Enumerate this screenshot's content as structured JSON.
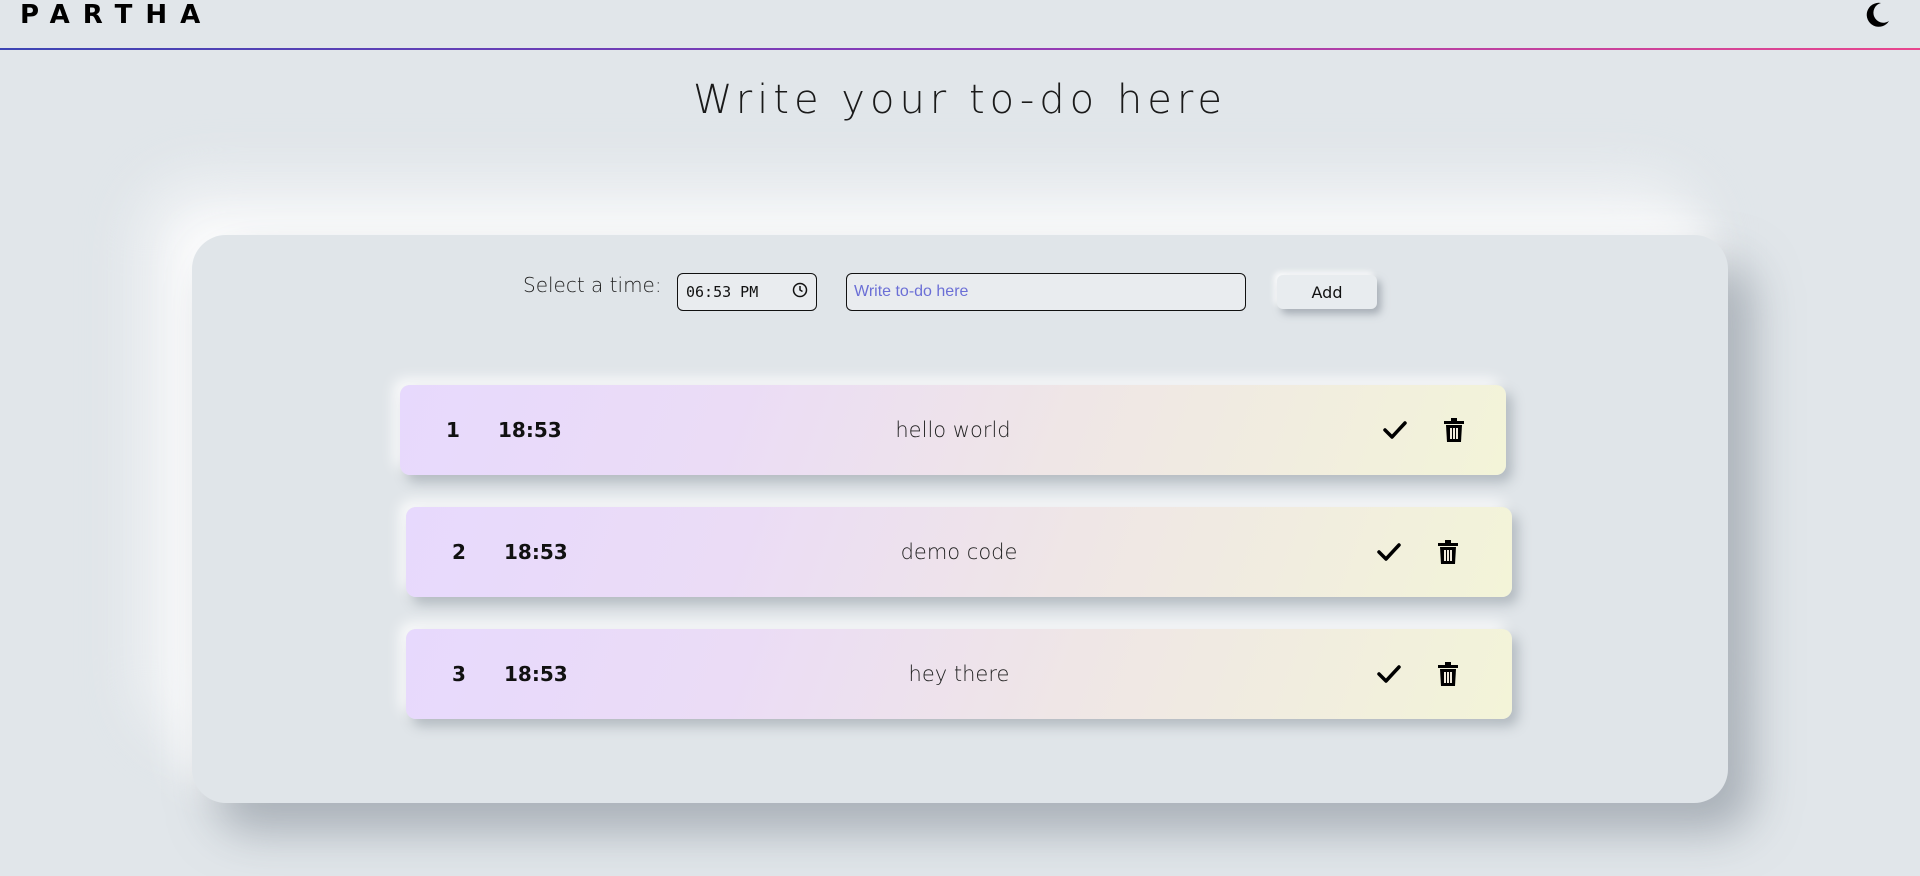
{
  "header": {
    "brand": "PARTHA",
    "theme_toggle_icon": "moon-icon"
  },
  "page": {
    "title": "Write your to-do here"
  },
  "form": {
    "time_label": "Select a time:",
    "time_value": "06:53 PM",
    "todo_placeholder": "Write to-do here",
    "todo_value": "",
    "add_label": "Add"
  },
  "todos": [
    {
      "num": "1",
      "time": "18:53",
      "text": "hello world"
    },
    {
      "num": "2",
      "time": "18:53",
      "text": "demo code"
    },
    {
      "num": "3",
      "time": "18:53",
      "text": "hey there"
    }
  ],
  "colors": {
    "background": "#e1e6ea",
    "accent_gradient_start": "#3c44b4",
    "accent_gradient_end": "#e8468e",
    "placeholder": "#6b6fd6"
  }
}
